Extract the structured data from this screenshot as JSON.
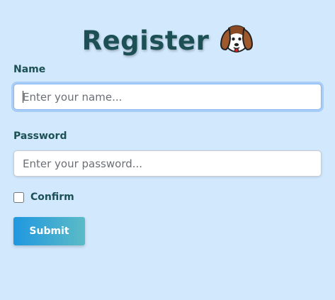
{
  "form": {
    "title": "Register",
    "title_icon": "dog-face-icon",
    "name": {
      "label": "Name",
      "placeholder": "Enter your name...",
      "value": ""
    },
    "password": {
      "label": "Password",
      "placeholder": "Enter your password...",
      "value": ""
    },
    "confirm": {
      "label": "Confirm",
      "checked": false
    },
    "submit_label": "Submit"
  },
  "colors": {
    "background": "#d1e8fd",
    "text": "#1c5055",
    "button_gradient_start": "#2098e0",
    "button_gradient_end": "#5bbbc6",
    "focus_ring": "#a9cdf7"
  }
}
